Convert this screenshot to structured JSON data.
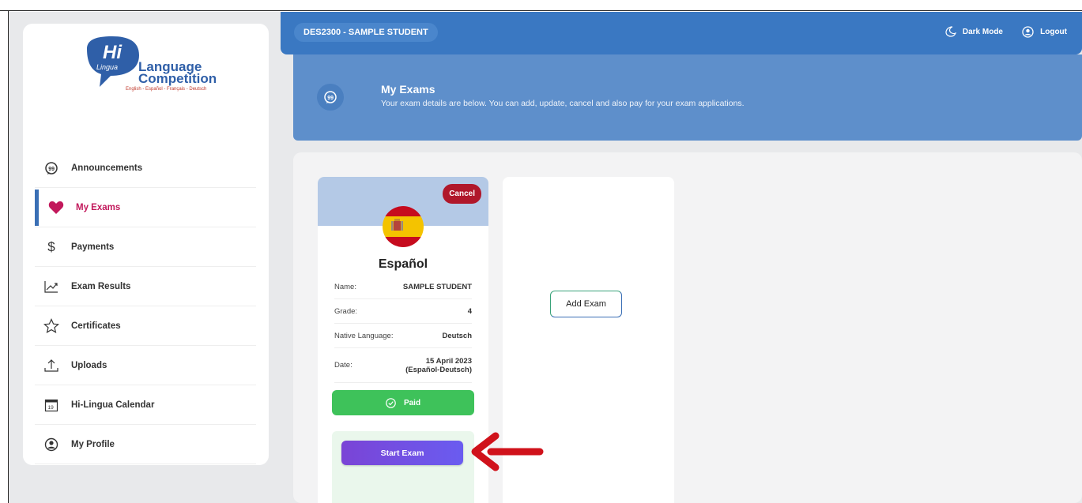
{
  "topbar": {
    "student": "DES2300 - SAMPLE STUDENT",
    "dark_mode": "Dark Mode",
    "logout": "Logout"
  },
  "logo": {
    "hi": "Hi",
    "lingua": "Lingua",
    "line1": "Language",
    "line2": "Competition",
    "languages": "English - Español - Français - Deutsch"
  },
  "sidebar": {
    "items": [
      {
        "label": "Announcements",
        "icon": "speech-bubble-icon"
      },
      {
        "label": "My Exams",
        "icon": "heart-icon",
        "active": true
      },
      {
        "label": "Payments",
        "icon": "dollar-icon"
      },
      {
        "label": "Exam Results",
        "icon": "chart-line-icon"
      },
      {
        "label": "Certificates",
        "icon": "star-icon"
      },
      {
        "label": "Uploads",
        "icon": "upload-icon"
      },
      {
        "label": "Hi-Lingua Calendar",
        "icon": "calendar-icon",
        "calendar_day": "19"
      },
      {
        "label": "My Profile",
        "icon": "user-circle-icon"
      }
    ]
  },
  "header": {
    "title": "My Exams",
    "description": "Your exam details are below. You can add, update, cancel and also pay for your exam applications."
  },
  "exam_card": {
    "cancel": "Cancel",
    "language": "Español",
    "fields": [
      {
        "label": "Name:",
        "value": "SAMPLE STUDENT"
      },
      {
        "label": "Grade:",
        "value": "4"
      },
      {
        "label": "Native Language:",
        "value": "Deutsch"
      },
      {
        "label": "Date:",
        "value": "15 April 2023",
        "value2": "(Español-Deutsch)"
      }
    ],
    "paid": "Paid",
    "start": "Start Exam"
  },
  "add_card": {
    "add": "Add Exam"
  },
  "colors": {
    "topbar": "#3a78c2",
    "header": "#5e8fcb",
    "active": "#c2185b",
    "cancel": "#b0172a",
    "paid": "#3ec25a",
    "start": "#7a44d6",
    "arrow": "#d0121b"
  }
}
